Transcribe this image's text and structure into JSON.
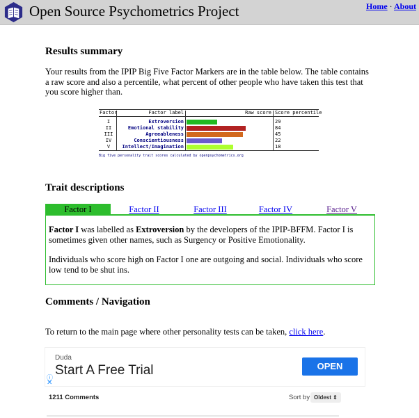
{
  "header": {
    "site_title": "Open Source Psychometrics Project",
    "home_link": "Home",
    "separator": "·",
    "about_link": "About",
    "logo_icon": "book-hexagon-icon",
    "bg_color": "#d3d3d3"
  },
  "results": {
    "heading": "Results summary",
    "intro": "Your results from the IPIP Big Five Factor Markers are in the table below. The table contains a raw score and also a percentile, what percent of other people who have taken this test that you score higher than.",
    "table": {
      "col_factor": "Factor",
      "col_label": "Factor label",
      "col_raw": "Raw score",
      "col_percentile": "Score percentile",
      "rows": [
        {
          "num": "I",
          "label": "Extroversion",
          "score": "29",
          "fill": 0.36,
          "color": "#22bb22"
        },
        {
          "num": "II",
          "label": "Emotional stability",
          "score": "84",
          "fill": 0.7,
          "color": "#b22222"
        },
        {
          "num": "III",
          "label": "Agreeableness",
          "score": "45",
          "fill": 0.66,
          "color": "#d2691e"
        },
        {
          "num": "IV",
          "label": "Conscientiousness",
          "score": "22",
          "fill": 0.42,
          "color": "#6a5acd"
        },
        {
          "num": "V",
          "label": "Intellect/Imagination",
          "score": "18",
          "fill": 0.55,
          "color": "#adff2f"
        }
      ],
      "caption": "Big five personality trait scores calculated by openpsychometrics.org"
    }
  },
  "traits": {
    "heading": "Trait descriptions",
    "tabs": [
      "Factor I",
      "Factor II",
      "Factor III",
      "Factor IV",
      "Factor V"
    ],
    "active_tab": 0,
    "accent_color": "#2dbd2d",
    "p1_bold1": "Factor I",
    "p1_text1": " was labelled as ",
    "p1_bold2": "Extroversion",
    "p1_text2": " by the developers of the IPIP-BFFM. Factor I is sometimes given other names, such as Surgency or Positive Emotionality.",
    "p2": "Individuals who score high on Factor I one are outgoing and social. Individuals who score low tend to be shut ins."
  },
  "comments_nav": {
    "heading": "Comments / Navigation",
    "return_text": "To return to the main page where other personality tests can be taken, ",
    "return_link": "click here",
    "return_end": "."
  },
  "ad": {
    "brand": "Duda",
    "headline": "Start A Free Trial",
    "button": "OPEN",
    "button_color": "#1a73e8",
    "info_icon": "ⓘ",
    "close_icon": "✕"
  },
  "comments": {
    "count": "1211 Comments",
    "sort_label": "Sort by",
    "sort_value": "Oldest ⇕"
  }
}
